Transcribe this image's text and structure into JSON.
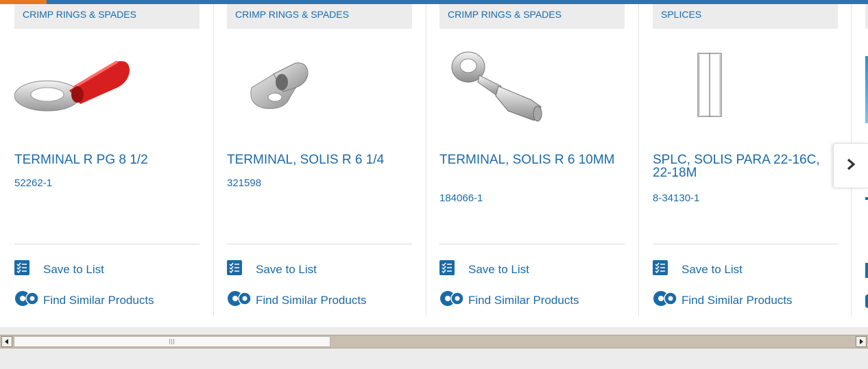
{
  "products": [
    {
      "category": "CRIMP RINGS & SPADES",
      "title": "TERMINAL R PG 8 1/2",
      "part_number": "52262-1",
      "save_label": "Save to List",
      "similar_label": "Find Similar Products"
    },
    {
      "category": "CRIMP RINGS & SPADES",
      "title": "TERMINAL, SOLIS R 6 1/4",
      "part_number": "321598",
      "save_label": "Save to List",
      "similar_label": "Find Similar Products"
    },
    {
      "category": "CRIMP RINGS & SPADES",
      "title": "TERMINAL, SOLIS R 6 10MM",
      "part_number": "184066-1",
      "save_label": "Save to List",
      "similar_label": "Find Similar Products"
    },
    {
      "category": "SPLICES",
      "title": "SPLC, SOLIS PARA 22-16C, 22-18M",
      "part_number": "8-34130-1",
      "save_label": "Save to List",
      "similar_label": "Find Similar Products"
    }
  ],
  "icons": {
    "save": "checklist-icon",
    "similar": "gears-icon",
    "next": "chevron-right-icon"
  },
  "colors": {
    "link": "#1a6aa8",
    "top_bar": "#2c74b3",
    "top_accent": "#e87722",
    "category_bg": "#ececec"
  }
}
